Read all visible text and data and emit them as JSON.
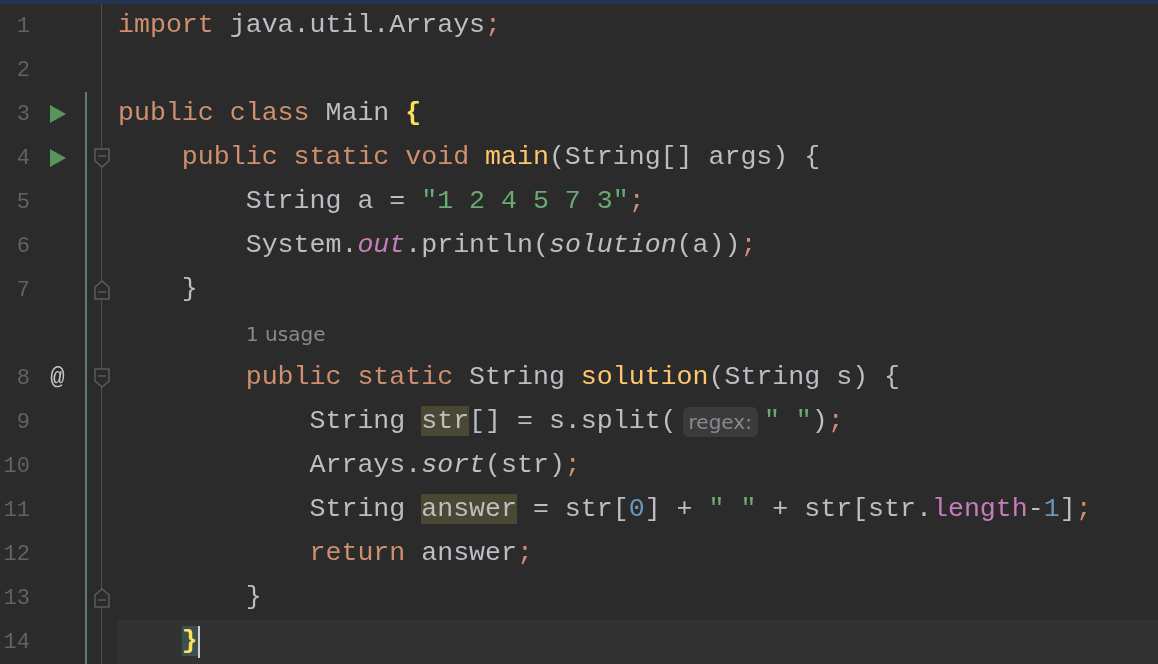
{
  "editor": {
    "rows": [
      {
        "kind": "code",
        "number": "1",
        "changed": false,
        "current": false,
        "tokens": [
          {
            "text": "import",
            "kind": "keyword"
          },
          {
            "text": " java.util.Arrays",
            "kind": "plain"
          },
          {
            "text": ";",
            "kind": "punct"
          }
        ]
      },
      {
        "kind": "code",
        "number": "2",
        "changed": false,
        "current": false,
        "tokens": []
      },
      {
        "kind": "code",
        "number": "3",
        "gutter": {
          "kind": "run"
        },
        "changed": true,
        "current": false,
        "tokens": [
          {
            "text": "public class ",
            "kind": "keyword"
          },
          {
            "text": "Main ",
            "kind": "plain"
          },
          {
            "text": "{",
            "kind": "brace"
          }
        ]
      },
      {
        "kind": "code",
        "number": "4",
        "gutter": {
          "kind": "run"
        },
        "fold": {
          "kind": "start"
        },
        "changed": true,
        "current": false,
        "tokens": [
          {
            "text": "    public static void ",
            "kind": "keyword"
          },
          {
            "text": "main",
            "kind": "method"
          },
          {
            "text": "(String[] args) {",
            "kind": "plain"
          }
        ]
      },
      {
        "kind": "code",
        "number": "5",
        "changed": true,
        "current": false,
        "tokens": [
          {
            "text": "        String a = ",
            "kind": "plain"
          },
          {
            "text": "\"1 2 4 5 7 3\"",
            "kind": "string"
          },
          {
            "text": ";",
            "kind": "punct"
          }
        ]
      },
      {
        "kind": "code",
        "number": "6",
        "changed": true,
        "current": false,
        "tokens": [
          {
            "text": "        System.",
            "kind": "plain"
          },
          {
            "text": "out",
            "kind": "static-field"
          },
          {
            "text": ".println(",
            "kind": "plain"
          },
          {
            "text": "solution",
            "kind": "static-call"
          },
          {
            "text": "(a))",
            "kind": "plain"
          },
          {
            "text": ";",
            "kind": "punct"
          }
        ]
      },
      {
        "kind": "code",
        "number": "7",
        "fold": {
          "kind": "end"
        },
        "changed": true,
        "current": false,
        "tokens": [
          {
            "text": "    }",
            "kind": "plain"
          }
        ]
      },
      {
        "kind": "usage",
        "changed": true,
        "text": "1 usage"
      },
      {
        "kind": "code",
        "number": "8",
        "gutter": {
          "kind": "text",
          "text": "@"
        },
        "fold": {
          "kind": "start"
        },
        "changed": true,
        "current": false,
        "tokens": [
          {
            "text": "        public static ",
            "kind": "keyword"
          },
          {
            "text": "String ",
            "kind": "plain"
          },
          {
            "text": "solution",
            "kind": "method"
          },
          {
            "text": "(String s) {",
            "kind": "plain"
          }
        ]
      },
      {
        "kind": "code",
        "number": "9",
        "changed": true,
        "current": false,
        "tokens": [
          {
            "text": "            String ",
            "kind": "plain"
          },
          {
            "text": "str",
            "kind": "marked"
          },
          {
            "text": "[] = s.split(",
            "kind": "plain"
          },
          {
            "text": "regex:",
            "kind": "hint"
          },
          {
            "text": "\" \"",
            "kind": "string"
          },
          {
            "text": ")",
            "kind": "plain"
          },
          {
            "text": ";",
            "kind": "punct"
          }
        ]
      },
      {
        "kind": "code",
        "number": "10",
        "changed": true,
        "current": false,
        "tokens": [
          {
            "text": "            Arrays.",
            "kind": "plain"
          },
          {
            "text": "sort",
            "kind": "static-call"
          },
          {
            "text": "(str)",
            "kind": "plain"
          },
          {
            "text": ";",
            "kind": "punct"
          }
        ]
      },
      {
        "kind": "code",
        "number": "11",
        "changed": true,
        "current": false,
        "tokens": [
          {
            "text": "            String ",
            "kind": "plain"
          },
          {
            "text": "answer",
            "kind": "marked"
          },
          {
            "text": " = str[",
            "kind": "plain"
          },
          {
            "text": "0",
            "kind": "number"
          },
          {
            "text": "] + ",
            "kind": "plain"
          },
          {
            "text": "\" \"",
            "kind": "string"
          },
          {
            "text": " + str[str.",
            "kind": "plain"
          },
          {
            "text": "length",
            "kind": "field"
          },
          {
            "text": "-",
            "kind": "plain"
          },
          {
            "text": "1",
            "kind": "number"
          },
          {
            "text": "]",
            "kind": "plain"
          },
          {
            "text": ";",
            "kind": "punct"
          }
        ]
      },
      {
        "kind": "code",
        "number": "12",
        "changed": true,
        "current": false,
        "tokens": [
          {
            "text": "            return ",
            "kind": "keyword"
          },
          {
            "text": "answer",
            "kind": "plain"
          },
          {
            "text": ";",
            "kind": "punct"
          }
        ]
      },
      {
        "kind": "code",
        "number": "13",
        "fold": {
          "kind": "end"
        },
        "changed": true,
        "current": false,
        "tokens": [
          {
            "text": "        }",
            "kind": "plain"
          }
        ]
      },
      {
        "kind": "code",
        "number": "14",
        "changed": true,
        "current": true,
        "tokens": [
          {
            "text": "    }",
            "kind": "brace-match"
          }
        ]
      }
    ]
  }
}
